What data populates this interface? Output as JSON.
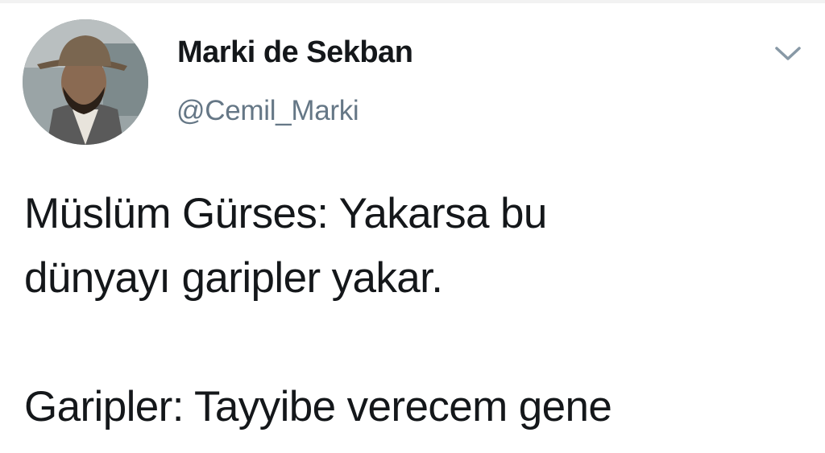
{
  "author": {
    "display_name": "Marki de Sekban",
    "handle": "@Cemil_Marki",
    "avatar_icon": "profile-photo"
  },
  "menu": {
    "icon": "chevron-down-icon"
  },
  "tweet": {
    "paragraphs": [
      "Müslüm Gürses: Yakarsa bu\ndünyayı garipler yakar.",
      "Garipler: Tayyibe verecem gene"
    ]
  },
  "colors": {
    "text": "#14171a",
    "secondary_text": "#657786",
    "caret": "#8899a6",
    "background": "#ffffff"
  }
}
